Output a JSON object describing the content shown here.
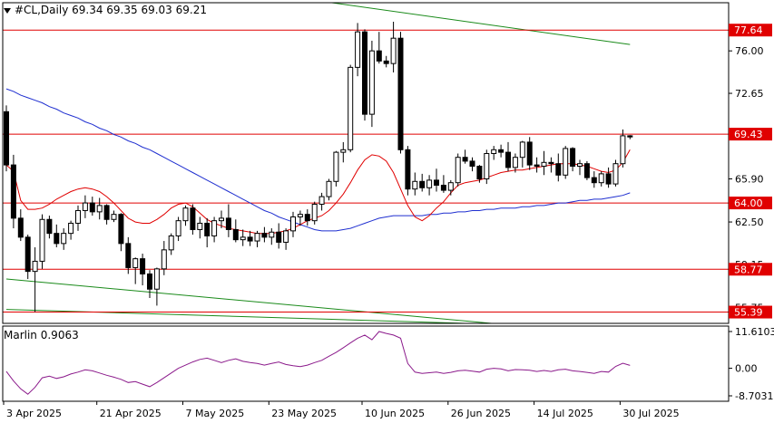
{
  "header": {
    "symbol_line": "#CL,Daily  69.34 69.35 69.03 69.21"
  },
  "indicator": {
    "label": "Marlin 0.9063",
    "color": "#8b1a8b",
    "ticks": [
      "11.6103",
      "0.00",
      "-8.7031"
    ],
    "tick_values": [
      11.6103,
      0,
      -8.7031
    ]
  },
  "colors": {
    "up_candle": "#ffffff",
    "down_candle": "#000000",
    "level_line": "#e00000",
    "ma_fast": "#e00000",
    "ma_slow": "#1f2fd0",
    "channel": "#1a8a1a",
    "level_label_bg": "#e00000"
  },
  "chart_data": [
    {
      "type": "candlestick",
      "ylim": [
        54.5,
        79.8
      ],
      "y_ticks": [
        "76.00",
        "72.65",
        "65.90",
        "62.50",
        "59.15",
        "55.75"
      ],
      "y_tick_values": [
        76.0,
        72.65,
        65.9,
        62.5,
        59.15,
        55.75
      ],
      "x_ticks": [
        "3 Apr 2025",
        "21 Apr 2025",
        "7 May 2025",
        "23 May 2025",
        "10 Jun 2025",
        "26 Jun 2025",
        "14 Jul 2025",
        "30 Jul 2025"
      ],
      "levels": [
        {
          "value": 77.64,
          "label": "77.64"
        },
        {
          "value": 69.43,
          "label": "69.43"
        },
        {
          "value": 64.0,
          "label": "64.00"
        },
        {
          "value": 58.77,
          "label": "58.77"
        },
        {
          "value": 55.39,
          "label": "55.39"
        }
      ],
      "candles": [
        [
          71.2,
          71.7,
          66.5,
          67.0
        ],
        [
          67.0,
          67.8,
          62.0,
          62.8
        ],
        [
          62.8,
          63.5,
          61.0,
          61.3
        ],
        [
          61.3,
          61.5,
          58.0,
          58.6
        ],
        [
          58.6,
          60.5,
          55.4,
          59.4
        ],
        [
          59.4,
          63.1,
          58.8,
          62.7
        ],
        [
          62.7,
          63.0,
          61.2,
          61.6
        ],
        [
          61.6,
          62.3,
          60.5,
          60.8
        ],
        [
          60.8,
          62.0,
          60.3,
          61.6
        ],
        [
          61.6,
          62.6,
          61.1,
          62.4
        ],
        [
          62.4,
          63.8,
          61.8,
          63.4
        ],
        [
          63.4,
          64.6,
          62.8,
          64.0
        ],
        [
          64.0,
          64.5,
          63.0,
          63.3
        ],
        [
          63.3,
          64.4,
          62.7,
          63.8
        ],
        [
          63.8,
          63.9,
          62.3,
          62.7
        ],
        [
          62.7,
          63.4,
          62.5,
          63.1
        ],
        [
          63.1,
          63.2,
          60.2,
          60.8
        ],
        [
          60.8,
          61.3,
          58.4,
          58.9
        ],
        [
          58.9,
          59.7,
          57.6,
          59.6
        ],
        [
          59.6,
          60.0,
          57.5,
          58.4
        ],
        [
          58.4,
          58.7,
          56.5,
          57.2
        ],
        [
          57.2,
          58.9,
          55.9,
          58.8
        ],
        [
          58.8,
          61.0,
          58.3,
          60.3
        ],
        [
          60.3,
          61.6,
          59.9,
          61.4
        ],
        [
          61.4,
          62.9,
          61.0,
          62.6
        ],
        [
          62.6,
          63.8,
          62.2,
          63.6
        ],
        [
          63.6,
          63.9,
          61.5,
          61.9
        ],
        [
          61.9,
          62.9,
          61.2,
          62.4
        ],
        [
          62.4,
          62.8,
          60.5,
          61.4
        ],
        [
          61.4,
          62.9,
          60.9,
          62.6
        ],
        [
          62.6,
          63.4,
          62.0,
          62.8
        ],
        [
          62.8,
          63.9,
          61.3,
          61.9
        ],
        [
          61.9,
          62.7,
          60.9,
          61.1
        ],
        [
          61.1,
          61.9,
          60.6,
          61.3
        ],
        [
          61.3,
          61.8,
          60.6,
          61.0
        ],
        [
          61.0,
          61.8,
          60.5,
          61.6
        ],
        [
          61.6,
          62.1,
          60.9,
          61.3
        ],
        [
          61.3,
          62.0,
          60.7,
          61.7
        ],
        [
          61.7,
          62.4,
          60.4,
          60.9
        ],
        [
          60.9,
          62.0,
          60.3,
          61.8
        ],
        [
          61.8,
          63.3,
          61.3,
          62.9
        ],
        [
          62.9,
          63.4,
          62.2,
          63.1
        ],
        [
          63.1,
          63.5,
          62.2,
          62.6
        ],
        [
          62.6,
          64.1,
          62.3,
          63.9
        ],
        [
          63.9,
          64.8,
          63.4,
          64.5
        ],
        [
          64.5,
          65.9,
          64.2,
          65.7
        ],
        [
          65.7,
          68.1,
          65.3,
          68.0
        ],
        [
          68.0,
          68.8,
          67.2,
          68.2
        ],
        [
          68.2,
          74.9,
          68.0,
          74.7
        ],
        [
          74.7,
          78.2,
          74.0,
          77.5
        ],
        [
          77.5,
          77.7,
          70.5,
          71.0
        ],
        [
          71.0,
          76.8,
          70.0,
          76.0
        ],
        [
          76.0,
          77.5,
          75.0,
          75.2
        ],
        [
          75.2,
          75.6,
          74.7,
          75.0
        ],
        [
          75.0,
          78.3,
          74.3,
          77.0
        ],
        [
          77.0,
          77.5,
          67.9,
          68.2
        ],
        [
          68.2,
          68.5,
          64.6,
          65.1
        ],
        [
          65.1,
          66.4,
          64.6,
          65.7
        ],
        [
          65.7,
          66.3,
          64.9,
          65.2
        ],
        [
          65.2,
          66.2,
          64.6,
          65.8
        ],
        [
          65.8,
          66.7,
          64.9,
          65.4
        ],
        [
          65.4,
          66.2,
          64.8,
          65.0
        ],
        [
          65.0,
          65.8,
          64.6,
          65.6
        ],
        [
          65.6,
          67.9,
          65.3,
          67.6
        ],
        [
          67.6,
          68.2,
          67.1,
          67.3
        ],
        [
          67.3,
          67.6,
          66.5,
          66.9
        ],
        [
          66.9,
          67.0,
          65.6,
          65.9
        ],
        [
          65.9,
          68.2,
          65.5,
          67.9
        ],
        [
          67.9,
          68.5,
          67.4,
          68.2
        ],
        [
          68.2,
          68.6,
          67.6,
          68.0
        ],
        [
          68.0,
          68.8,
          66.5,
          66.8
        ],
        [
          66.8,
          67.9,
          66.4,
          67.6
        ],
        [
          67.6,
          68.9,
          66.8,
          68.8
        ],
        [
          68.8,
          69.2,
          66.6,
          67.0
        ],
        [
          67.0,
          67.6,
          66.4,
          66.9
        ],
        [
          66.9,
          68.1,
          66.2,
          67.2
        ],
        [
          67.2,
          67.6,
          66.4,
          67.1
        ],
        [
          67.1,
          67.9,
          65.7,
          66.2
        ],
        [
          66.2,
          68.5,
          65.9,
          68.3
        ],
        [
          68.3,
          68.4,
          66.5,
          66.9
        ],
        [
          66.9,
          67.4,
          66.2,
          67.1
        ],
        [
          67.1,
          67.3,
          65.8,
          66.0
        ],
        [
          66.0,
          66.5,
          65.2,
          65.6
        ],
        [
          65.6,
          66.5,
          65.3,
          66.3
        ],
        [
          66.3,
          66.8,
          65.2,
          65.5
        ],
        [
          65.5,
          67.4,
          65.3,
          67.1
        ],
        [
          67.1,
          69.8,
          66.8,
          69.3
        ],
        [
          69.3,
          69.35,
          69.03,
          69.21
        ]
      ],
      "ma_fast": [
        67.0,
        66.5,
        64.2,
        63.5,
        63.5,
        63.6,
        63.9,
        64.3,
        64.6,
        64.9,
        65.1,
        65.2,
        65.1,
        64.9,
        64.5,
        64.0,
        63.4,
        62.8,
        62.5,
        62.4,
        62.4,
        62.7,
        63.1,
        63.6,
        63.9,
        64.0,
        63.7,
        63.2,
        62.7,
        62.4,
        62.2,
        62.0,
        61.9,
        61.8,
        61.7,
        61.6,
        61.6,
        61.6,
        61.7,
        61.8,
        62.0,
        62.3,
        62.6,
        62.8,
        63.0,
        63.4,
        64.0,
        64.7,
        65.6,
        66.6,
        67.4,
        67.8,
        67.7,
        67.3,
        66.4,
        65.1,
        63.8,
        62.9,
        62.6,
        63.0,
        63.6,
        64.1,
        64.8,
        65.4,
        65.6,
        65.7,
        65.8,
        66.0,
        66.2,
        66.4,
        66.5,
        66.6,
        66.6,
        66.7,
        66.8,
        66.9,
        67.0,
        67.1,
        67.1,
        67.1,
        67.0,
        66.9,
        66.7,
        66.5,
        66.4,
        66.6,
        67.2,
        68.2
      ],
      "ma_slow": [
        73.0,
        72.8,
        72.5,
        72.3,
        72.1,
        71.9,
        71.6,
        71.4,
        71.1,
        70.9,
        70.7,
        70.4,
        70.2,
        69.9,
        69.7,
        69.4,
        69.2,
        68.9,
        68.7,
        68.4,
        68.2,
        67.9,
        67.6,
        67.3,
        67.0,
        66.7,
        66.4,
        66.1,
        65.8,
        65.5,
        65.2,
        64.9,
        64.6,
        64.3,
        64.0,
        63.7,
        63.4,
        63.2,
        62.9,
        62.7,
        62.5,
        62.3,
        62.1,
        61.9,
        61.8,
        61.8,
        61.8,
        61.9,
        62.0,
        62.2,
        62.4,
        62.6,
        62.8,
        62.9,
        63.0,
        63.0,
        63.0,
        63.0,
        63.0,
        63.1,
        63.1,
        63.2,
        63.2,
        63.3,
        63.3,
        63.4,
        63.4,
        63.5,
        63.5,
        63.6,
        63.6,
        63.6,
        63.7,
        63.7,
        63.8,
        63.8,
        63.9,
        64.0,
        64.0,
        64.1,
        64.2,
        64.2,
        64.3,
        64.3,
        64.4,
        64.5,
        64.6,
        64.8
      ],
      "marlin": [
        -1.0,
        -4.0,
        -6.5,
        -8.2,
        -6.0,
        -3.0,
        -2.5,
        -3.2,
        -2.7,
        -1.8,
        -1.2,
        -0.5,
        -0.8,
        -1.5,
        -2.2,
        -2.8,
        -3.5,
        -4.5,
        -4.2,
        -5.0,
        -5.8,
        -4.5,
        -3.0,
        -1.5,
        0.0,
        1.0,
        2.0,
        2.8,
        3.2,
        2.5,
        1.8,
        2.5,
        3.0,
        2.2,
        1.8,
        1.5,
        1.0,
        1.5,
        2.0,
        1.2,
        0.8,
        0.5,
        1.0,
        1.8,
        2.5,
        3.8,
        5.0,
        6.5,
        8.0,
        9.5,
        10.5,
        9.0,
        11.6,
        11.0,
        10.5,
        9.5,
        1.5,
        -1.2,
        -1.6,
        -1.4,
        -1.2,
        -1.6,
        -1.3,
        -0.8,
        -0.6,
        -0.9,
        -1.2,
        -0.3,
        0.0,
        -0.2,
        -0.8,
        -0.4,
        -0.5,
        -0.6,
        -1.0,
        -0.7,
        -1.0,
        -0.5,
        -0.3,
        -0.8,
        -1.0,
        -1.3,
        -1.6,
        -1.0,
        -1.2,
        0.6,
        1.6,
        0.9
      ],
      "channels": [
        {
          "from": [
            0,
            83.4
          ],
          "to": [
            87,
            76.5
          ]
        },
        {
          "from": [
            0,
            58.0
          ],
          "to": [
            87,
            53.5
          ]
        },
        {
          "from": [
            0,
            55.6
          ],
          "to": [
            70,
            54.4
          ]
        }
      ]
    }
  ]
}
